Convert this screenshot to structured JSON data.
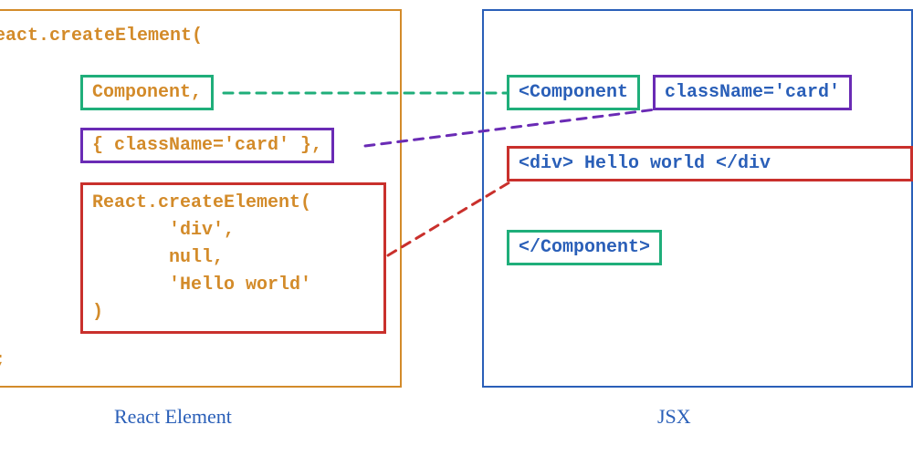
{
  "captions": {
    "left": "React Element",
    "right": "JSX"
  },
  "left": {
    "head": "eact.createElement(",
    "component": "Component,",
    "className": "{ className='card' },",
    "child": "React.createElement(\n       'div',\n       null,\n       'Hello world'\n)",
    "tail": ";"
  },
  "right": {
    "componentOpen": "<Component",
    "className": "className='card'",
    "child": "<div> Hello world </div",
    "componentClose": "</Component>"
  },
  "colors": {
    "green": "#1fae7a",
    "purple": "#6a2bb5",
    "red": "#c9302c",
    "orange": "#d38b2a",
    "blue": "#2a5fb8"
  }
}
